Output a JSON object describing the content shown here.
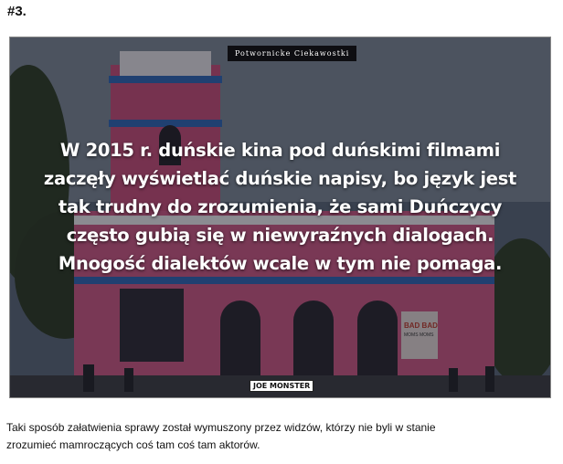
{
  "post": {
    "number": "#3.",
    "image": {
      "brand_label": "Potwornicke Ciekawostki",
      "caption_lines": [
        "W 2015 r. duńskie kina pod duńskimi filmami",
        "zaczęły wyświetlać duńskie napisy, bo język jest",
        "tak trudny do zrozumienia, że sami Duńczycy",
        "często gubią się w niewyraźnych dialogach.",
        "Mnogość dialektów wcale w tym nie pomaga."
      ],
      "watermark": "JOE MONSTER",
      "sign": {
        "top": "BAD BAD",
        "bottom": "MOMS MOMS"
      }
    },
    "description_lines": [
      "Taki sposób załatwienia sprawy został wymuszony przez widzów, którzy nie byli w stanie",
      "zrozumieć mamroczących coś tam coś tam aktorów."
    ]
  }
}
